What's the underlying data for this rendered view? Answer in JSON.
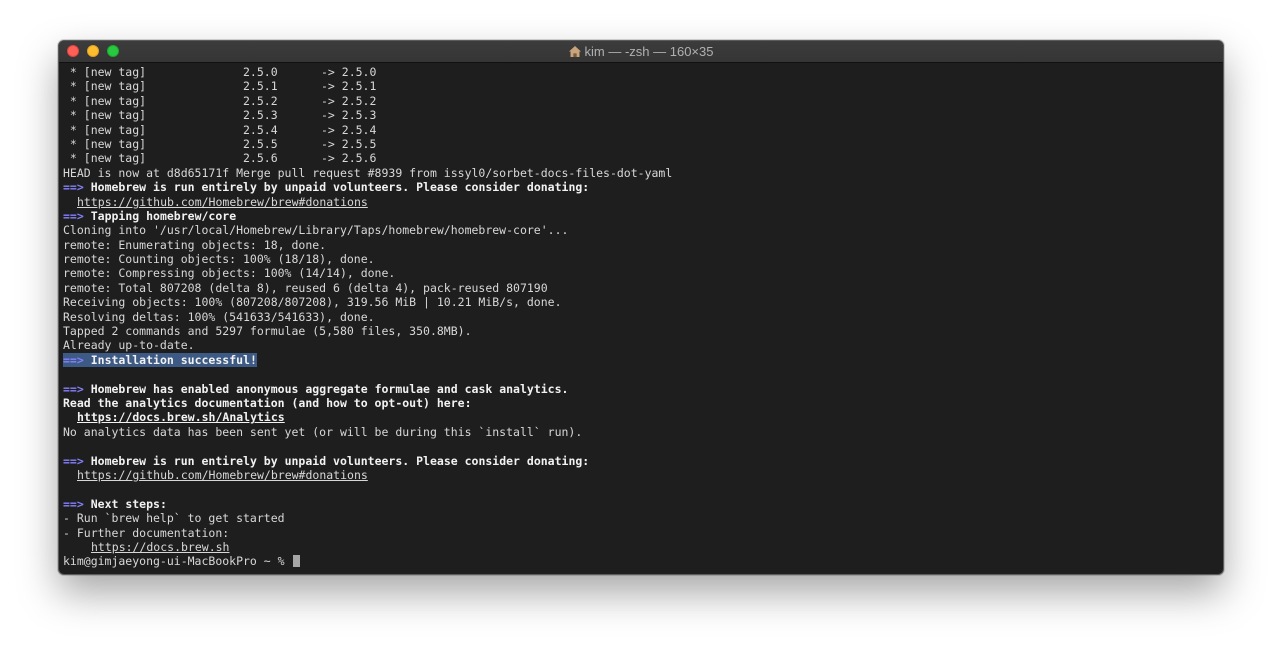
{
  "window": {
    "title": "kim — -zsh — 160×35"
  },
  "terminal": {
    "tags": [
      {
        "col1": " * [new tag]",
        "col2": "2.5.0",
        "col3": "-> 2.5.0"
      },
      {
        "col1": " * [new tag]",
        "col2": "2.5.1",
        "col3": "-> 2.5.1"
      },
      {
        "col1": " * [new tag]",
        "col2": "2.5.2",
        "col3": "-> 2.5.2"
      },
      {
        "col1": " * [new tag]",
        "col2": "2.5.3",
        "col3": "-> 2.5.3"
      },
      {
        "col1": " * [new tag]",
        "col2": "2.5.4",
        "col3": "-> 2.5.4"
      },
      {
        "col1": " * [new tag]",
        "col2": "2.5.5",
        "col3": "-> 2.5.5"
      },
      {
        "col1": " * [new tag]",
        "col2": "2.5.6",
        "col3": "-> 2.5.6"
      }
    ],
    "arrow": "==>",
    "head_line": "HEAD is now at d8d65171f Merge pull request #8939 from issyl0/sorbet-docs-files-dot-yaml",
    "volunteers_msg": "Homebrew is run entirely by unpaid volunteers. Please consider donating:",
    "donations_url": "https://github.com/Homebrew/brew#donations",
    "tapping": "Tapping homebrew/core",
    "output": [
      "Cloning into '/usr/local/Homebrew/Library/Taps/homebrew/homebrew-core'...",
      "remote: Enumerating objects: 18, done.",
      "remote: Counting objects: 100% (18/18), done.",
      "remote: Compressing objects: 100% (14/14), done.",
      "remote: Total 807208 (delta 8), reused 6 (delta 4), pack-reused 807190",
      "Receiving objects: 100% (807208/807208), 319.56 MiB | 10.21 MiB/s, done.",
      "Resolving deltas: 100% (541633/541633), done.",
      "Tapped 2 commands and 5297 formulae (5,580 files, 350.8MB).",
      "Already up-to-date."
    ],
    "install_success": "Installation successful!",
    "analytics_msg": "Homebrew has enabled anonymous aggregate formulae and cask analytics.",
    "analytics_read": "Read the analytics documentation (and how to opt-out) here:",
    "analytics_url": "https://docs.brew.sh/Analytics",
    "analytics_none": "No analytics data has been sent yet (or will be during this `install` run).",
    "next_steps": "Next steps:",
    "step1": "- Run `brew help` to get started",
    "step2": "- Further documentation:",
    "docs_url": "https://docs.brew.sh",
    "prompt": "kim@gimjaeyong-ui-MacBookPro ~ % "
  },
  "colors": {
    "background": "#1e1e1e",
    "arrow": "#8680ff",
    "selection": "#3d5a84"
  }
}
